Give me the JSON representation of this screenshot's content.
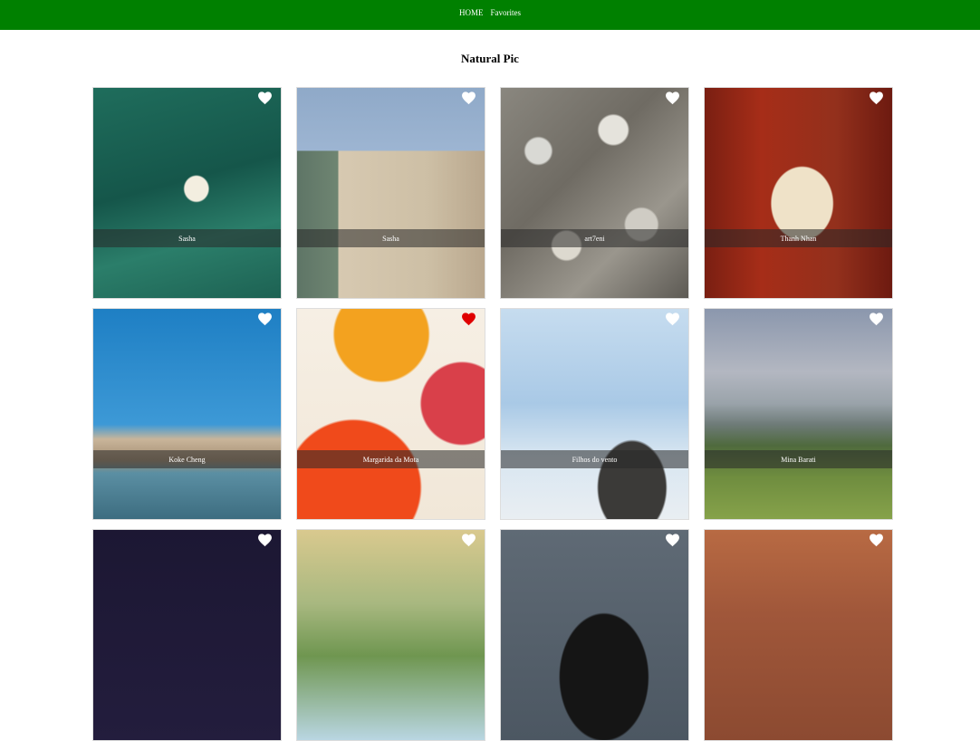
{
  "nav": {
    "home_label": "HOME",
    "favorites_label": "Favorites"
  },
  "page": {
    "title": "Natural Pic"
  },
  "colors": {
    "nav_bg": "#008000",
    "heart_default": "#ffffff",
    "heart_active": "#e00000"
  },
  "photos": [
    {
      "author": "Sasha",
      "favorited": false,
      "icon": "heart-icon"
    },
    {
      "author": "Sasha",
      "favorited": false,
      "icon": "heart-icon"
    },
    {
      "author": "art7eni",
      "favorited": false,
      "icon": "heart-icon"
    },
    {
      "author": "Thanh Nhan",
      "favorited": false,
      "icon": "heart-icon"
    },
    {
      "author": "Koke Cheng",
      "favorited": false,
      "icon": "heart-icon"
    },
    {
      "author": "Margarida da Mota",
      "favorited": true,
      "icon": "heart-icon"
    },
    {
      "author": "Filhos do vento",
      "favorited": false,
      "icon": "heart-icon"
    },
    {
      "author": "Mina Barati",
      "favorited": false,
      "icon": "heart-icon"
    },
    {
      "author": "",
      "favorited": false,
      "icon": "heart-icon"
    },
    {
      "author": "",
      "favorited": false,
      "icon": "heart-icon"
    },
    {
      "author": "",
      "favorited": false,
      "icon": "heart-icon"
    },
    {
      "author": "",
      "favorited": false,
      "icon": "heart-icon"
    }
  ]
}
